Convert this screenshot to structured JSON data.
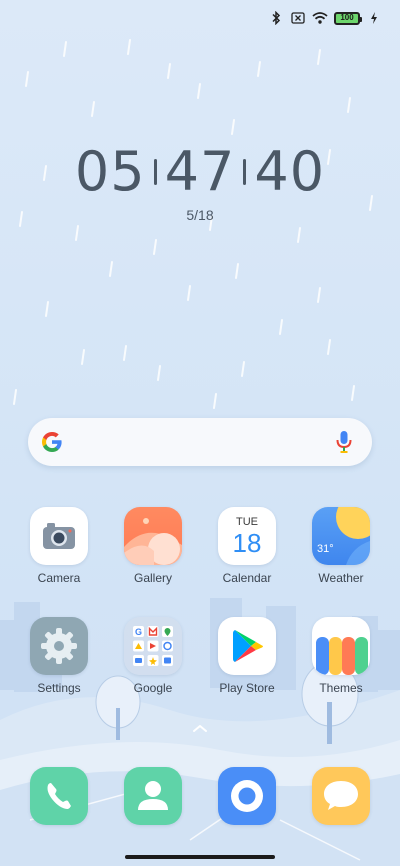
{
  "status_bar": {
    "battery_level": "100",
    "icons": [
      "bluetooth-icon",
      "no-sim-icon",
      "wifi-icon",
      "battery-icon",
      "charging-icon"
    ]
  },
  "clock": {
    "hours": "05",
    "minutes": "47",
    "seconds": "40",
    "date": "5/18"
  },
  "search": {
    "logo": "google-g-icon",
    "voice": "mic-icon"
  },
  "apps_row1": [
    {
      "label": "Camera"
    },
    {
      "label": "Gallery"
    },
    {
      "label": "Calendar",
      "day": "TUE",
      "date": "18"
    },
    {
      "label": "Weather",
      "temp": "31°"
    }
  ],
  "apps_row2": [
    {
      "label": "Settings"
    },
    {
      "label": "Google"
    },
    {
      "label": "Play Store"
    },
    {
      "label": "Themes"
    }
  ],
  "dock": [
    "phone-icon",
    "contacts-icon",
    "browser-icon",
    "messages-icon"
  ],
  "colors": {
    "phone": "#5fd3a8",
    "contacts": "#5fd3a8",
    "browser": "#4a8ef7",
    "messages": "#ffc85a",
    "wallpaper": "#d6e6f7"
  }
}
